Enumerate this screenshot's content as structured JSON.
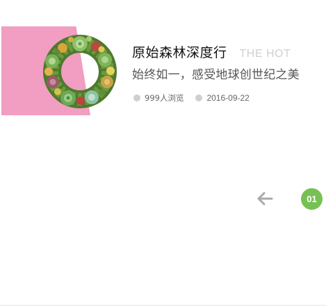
{
  "article": {
    "title": "原始森林深度行",
    "tag": "THE HOT",
    "subtitle": "始终如一，感受地球创世纪之美",
    "views": "999人浏览",
    "date": "2016-09-22",
    "image_icon": "succulent-wreath",
    "accent_color": "#f19ec2"
  },
  "pager": {
    "prev_icon": "arrow-left-icon",
    "current_page": "01",
    "badge_color": "#76c154"
  }
}
